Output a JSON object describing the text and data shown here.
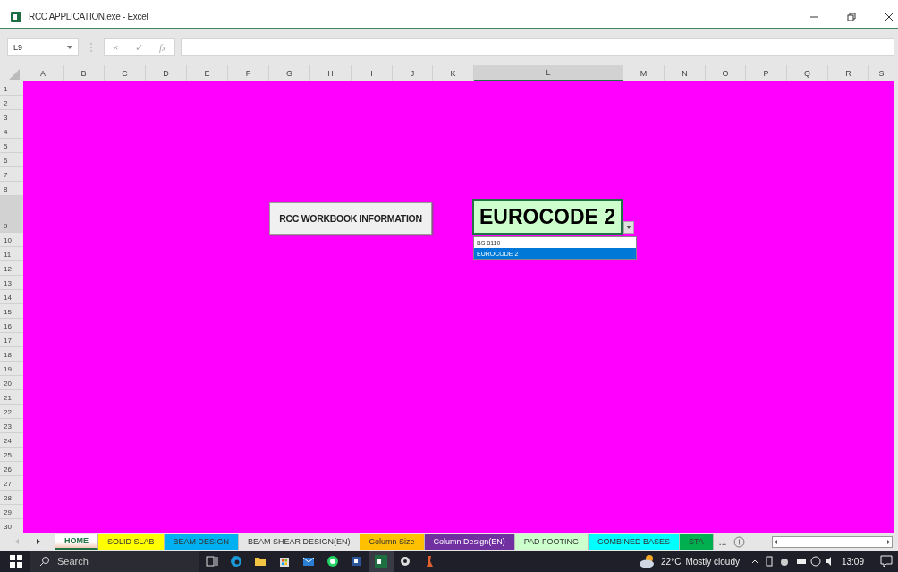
{
  "window": {
    "title": "RCC APPLICATION.exe - Excel"
  },
  "formula_bar": {
    "name_box": "L9",
    "cancel": "×",
    "enter": "✓",
    "function": "fx"
  },
  "columns": [
    {
      "label": "A",
      "selected": false
    },
    {
      "label": "B",
      "selected": false
    },
    {
      "label": "C",
      "selected": false
    },
    {
      "label": "D",
      "selected": false
    },
    {
      "label": "E",
      "selected": false
    },
    {
      "label": "F",
      "selected": false
    },
    {
      "label": "G",
      "selected": false
    },
    {
      "label": "H",
      "selected": false
    },
    {
      "label": "I",
      "selected": false
    },
    {
      "label": "J",
      "selected": false
    },
    {
      "label": "K",
      "selected": false
    },
    {
      "label": "L",
      "selected": true
    },
    {
      "label": "M",
      "selected": false
    },
    {
      "label": "N",
      "selected": false
    },
    {
      "label": "O",
      "selected": false
    },
    {
      "label": "P",
      "selected": false
    },
    {
      "label": "Q",
      "selected": false
    },
    {
      "label": "R",
      "selected": false
    },
    {
      "label": "S",
      "selected": false
    }
  ],
  "rows": [
    {
      "label": "1",
      "selected": false
    },
    {
      "label": "2",
      "selected": false
    },
    {
      "label": "3",
      "selected": false
    },
    {
      "label": "4",
      "selected": false
    },
    {
      "label": "5",
      "selected": false
    },
    {
      "label": "6",
      "selected": false
    },
    {
      "label": "7",
      "selected": false
    },
    {
      "label": "8",
      "selected": false
    },
    {
      "label": "9",
      "selected": true
    },
    {
      "label": "10",
      "selected": false
    },
    {
      "label": "11",
      "selected": false
    },
    {
      "label": "12",
      "selected": false
    },
    {
      "label": "13",
      "selected": false
    },
    {
      "label": "14",
      "selected": false
    },
    {
      "label": "15",
      "selected": false
    },
    {
      "label": "16",
      "selected": false
    },
    {
      "label": "17",
      "selected": false
    },
    {
      "label": "18",
      "selected": false
    },
    {
      "label": "19",
      "selected": false
    },
    {
      "label": "20",
      "selected": false
    },
    {
      "label": "21",
      "selected": false
    },
    {
      "label": "22",
      "selected": false
    },
    {
      "label": "23",
      "selected": false
    },
    {
      "label": "24",
      "selected": false
    },
    {
      "label": "25",
      "selected": false
    },
    {
      "label": "26",
      "selected": false
    },
    {
      "label": "27",
      "selected": false
    },
    {
      "label": "28",
      "selected": false
    },
    {
      "label": "29",
      "selected": false
    },
    {
      "label": "30",
      "selected": false
    }
  ],
  "sheet": {
    "info_button": "RCC WORKBOOK INFORMATION",
    "code_cell": "EUROCODE 2",
    "code_options": [
      {
        "label": "BS 8110",
        "selected": false
      },
      {
        "label": "EUROCODE 2",
        "selected": true
      }
    ]
  },
  "sheet_tabs": [
    {
      "label": "HOME",
      "selected": true
    },
    {
      "label": "SOLID SLAB",
      "selected": false,
      "color": "#ffff00"
    },
    {
      "label": "BEAM DESIGN",
      "selected": false,
      "color": "#00b0f0"
    },
    {
      "label": "BEAM SHEAR DESIGN(EN)",
      "selected": false
    },
    {
      "label": "Column Size",
      "selected": false,
      "color": "#ffc000"
    },
    {
      "label": "Column Design(EN)",
      "selected": false,
      "color": "#7030a0"
    },
    {
      "label": "PAD FOOTING",
      "selected": false,
      "color": "#ccffcc"
    },
    {
      "label": "COMBINED BASES",
      "selected": false,
      "color": "#00ffff"
    },
    {
      "label": "STA",
      "selected": false,
      "color": "#00b050"
    }
  ],
  "more_tabs": "...",
  "taskbar": {
    "search": {
      "placeholder": "Search"
    },
    "temperature": "22°C",
    "weather": "Mostly cloudy",
    "time": "13:09"
  }
}
